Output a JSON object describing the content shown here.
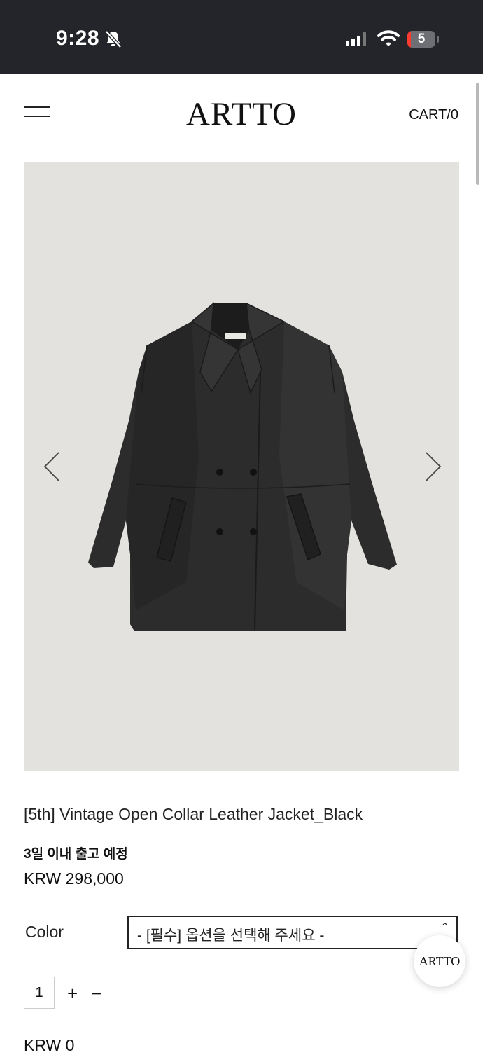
{
  "status_bar": {
    "time": "9:28",
    "battery": "5",
    "icons": [
      "bell-off-icon",
      "cellular-signal-icon",
      "wifi-icon",
      "battery-icon"
    ]
  },
  "header": {
    "logo": "ARTTO",
    "cart": "CART/0",
    "menu_icon": "hamburger-menu-icon"
  },
  "gallery": {
    "prev_icon": "chevron-left-icon",
    "next_icon": "chevron-right-icon",
    "background": "#e3e2df"
  },
  "product": {
    "name": "[5th] Vintage Open Collar Leather Jacket_Black",
    "shipping_note": "3일 이내 출고 예정",
    "price": "KRW 298,000"
  },
  "options": {
    "label": "Color",
    "selected": "- [필수] 옵션을 선택해 주세요 -"
  },
  "quantity": {
    "value": "1",
    "plus": "+",
    "minus": "−"
  },
  "total": "KRW 0",
  "floating_badge": "ARTTO"
}
